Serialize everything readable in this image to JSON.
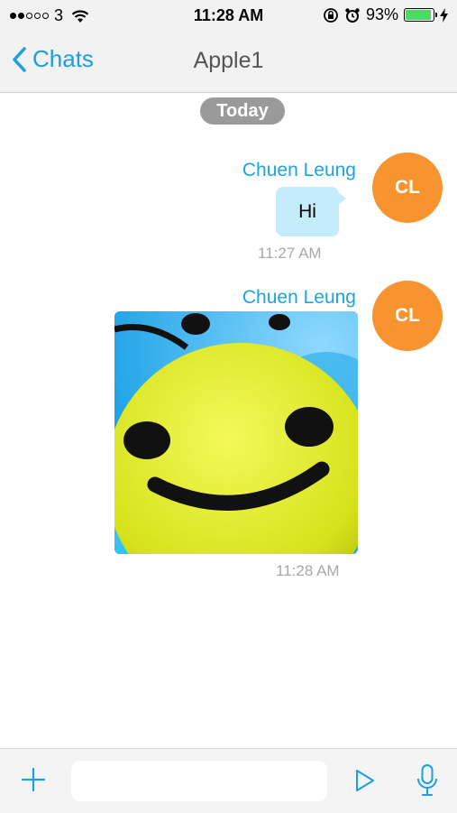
{
  "status_bar": {
    "carrier": "3",
    "signal_dots_filled": 2,
    "signal_dots_total": 5,
    "time": "11:28 AM",
    "battery_percent": "93%",
    "battery_level": 0.93,
    "icons": [
      "wifi-icon",
      "rotation-lock-icon",
      "alarm-icon",
      "battery-icon",
      "charging-bolt-icon"
    ]
  },
  "nav": {
    "back_label": "Chats",
    "title": "Apple1"
  },
  "chat": {
    "date_divider": "Today",
    "messages": [
      {
        "sender": "Chuen Leung",
        "avatar_initials": "CL",
        "type": "text",
        "text": "Hi",
        "time": "11:27 AM"
      },
      {
        "sender": "Chuen Leung",
        "avatar_initials": "CL",
        "type": "image",
        "image_description": "smiley",
        "time": "11:28 AM"
      }
    ]
  },
  "input_bar": {
    "placeholder": "",
    "icons": [
      "plus-icon",
      "send-icon",
      "microphone-icon"
    ]
  },
  "colors": {
    "accent": "#1a9fe0",
    "avatar": "#f7942f",
    "bubble": "#c5ecfb",
    "date_pill": "#9a9a9a",
    "battery": "#4cd964"
  }
}
